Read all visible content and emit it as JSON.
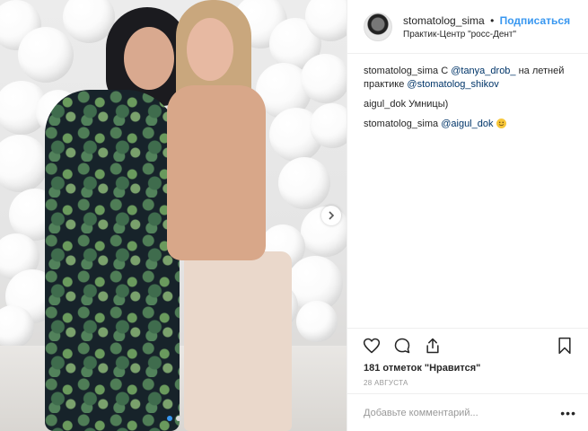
{
  "post": {
    "username": "stomatolog_sima",
    "separator": "•",
    "follow_label": "Подписаться",
    "location": "Практик-Центр \"росс-Дент\"",
    "comments": [
      {
        "user": "stomatolog_sima",
        "parts": [
          {
            "text": " С "
          },
          {
            "text": "@tanya_drob_",
            "mention": true
          },
          {
            "text": " на летней практике "
          },
          {
            "text": "@stomatolog_shikov",
            "mention": true
          }
        ]
      },
      {
        "user": "aigul_dok",
        "parts": [
          {
            "text": " Умницы)"
          }
        ]
      },
      {
        "user": "stomatolog_sima",
        "parts": [
          {
            "text": " "
          },
          {
            "text": "@aigul_dok",
            "mention": true
          },
          {
            "text": " "
          }
        ],
        "emoji": "smiling-face-emoji"
      }
    ],
    "likes": "181 отметок \"Нравится\"",
    "date": "28 АВГУСТА",
    "add_comment_placeholder": "Добавьте комментарий...",
    "more_label": "•••"
  },
  "carousel": {
    "total": 2,
    "active_index": 0
  },
  "icons": {
    "like": "heart-icon",
    "comment": "comment-icon",
    "share": "share-icon",
    "save": "bookmark-icon",
    "next": "chevron-right-icon"
  },
  "colors": {
    "link": "#3897f0",
    "mention": "#003569",
    "text": "#262626",
    "muted": "#999999",
    "border": "#efefef"
  }
}
